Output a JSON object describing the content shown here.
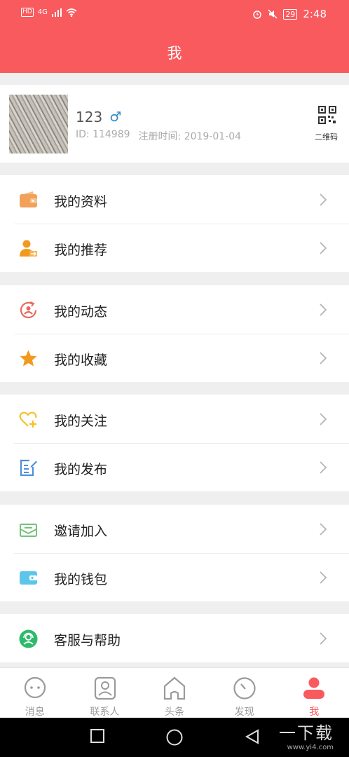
{
  "status_bar": {
    "hd": "HD",
    "network": "4G",
    "battery": "29",
    "time": "2:48"
  },
  "header": {
    "title": "我"
  },
  "profile": {
    "name": "123",
    "gender_symbol": "♂",
    "id_text": "ID: 114989",
    "register_text": "注册时间: 2019-01-04",
    "qr_label": "二维码"
  },
  "menu": [
    {
      "label": "我的资料",
      "icon": "wallet-icon",
      "color": "#f2a15a"
    },
    {
      "label": "我的推荐",
      "icon": "user-share-icon",
      "color": "#f29a1f"
    },
    {
      "label": "我的动态",
      "icon": "activity-refresh-icon",
      "color": "#e8685b"
    },
    {
      "label": "我的收藏",
      "icon": "star-icon",
      "color": "#f29a1f"
    },
    {
      "label": "我的关注",
      "icon": "heart-plus-icon",
      "color": "#f5c12c"
    },
    {
      "label": "我的发布",
      "icon": "edit-document-icon",
      "color": "#4d8fe0"
    },
    {
      "label": "邀请加入",
      "icon": "envelope-icon",
      "color": "#72c27a"
    },
    {
      "label": "我的钱包",
      "icon": "card-icon",
      "color": "#5cc6ea"
    },
    {
      "label": "客服与帮助",
      "icon": "customer-service-icon",
      "color": "#2fba6b"
    }
  ],
  "tabs": [
    {
      "label": "消息",
      "icon": "chat-bubble-icon"
    },
    {
      "label": "联系人",
      "icon": "contact-card-icon"
    },
    {
      "label": "头条",
      "icon": "home-icon"
    },
    {
      "label": "发现",
      "icon": "compass-icon"
    },
    {
      "label": "我",
      "icon": "person-icon",
      "active": true
    }
  ],
  "watermark": {
    "brand": "一下载",
    "url": "www.yi4.com"
  },
  "colors": {
    "primary": "#f85a5e",
    "background": "#efefef",
    "tab_inactive": "#9a9a9a"
  }
}
